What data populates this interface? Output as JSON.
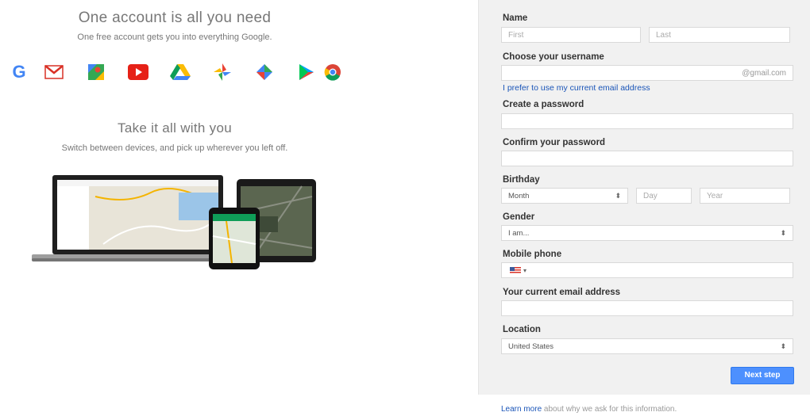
{
  "left": {
    "headline": "One account is all you need",
    "subline": "One free account gets you into everything Google.",
    "apps": [
      {
        "icon": "google-search-icon",
        "glyph": "G",
        "color": "#4285f4"
      },
      {
        "icon": "gmail-icon",
        "glyph": "M",
        "color": "#d93025"
      },
      {
        "icon": "maps-icon",
        "glyph": "",
        "color": "#34a853"
      },
      {
        "icon": "youtube-icon",
        "glyph": "",
        "color": "#e62117"
      },
      {
        "icon": "drive-icon",
        "glyph": "",
        "color": "#0f9d58"
      },
      {
        "icon": "photos-icon",
        "glyph": "",
        "color": "#fbbc05"
      },
      {
        "icon": "google-plus-icon",
        "glyph": "",
        "color": "#4285f4"
      },
      {
        "icon": "play-store-icon",
        "glyph": "",
        "color": "#00a0ff"
      },
      {
        "icon": "chrome-icon",
        "glyph": "",
        "color": "#db4437"
      }
    ],
    "headline2": "Take it all with you",
    "subline2": "Switch between devices, and pick up wherever you left off."
  },
  "form": {
    "name_label": "Name",
    "first_placeholder": "First",
    "last_placeholder": "Last",
    "username_label": "Choose your username",
    "username_suffix": "@gmail.com",
    "current_email_link": "I prefer to use my current email address",
    "password_label": "Create a password",
    "confirm_label": "Confirm your password",
    "birthday_label": "Birthday",
    "month_value": "Month",
    "day_placeholder": "Day",
    "year_placeholder": "Year",
    "gender_label": "Gender",
    "gender_value": "I am...",
    "phone_label": "Mobile phone",
    "current_email_label": "Your current email address",
    "location_label": "Location",
    "location_value": "United States",
    "next_button": "Next step",
    "select_arrow": "⬍"
  },
  "footer": {
    "learn_more": "Learn more",
    "rest": " about why we ask for this information."
  },
  "colors": {
    "accent": "#4d90fe",
    "link": "#1a55b8",
    "panel": "#f1f1f1"
  }
}
